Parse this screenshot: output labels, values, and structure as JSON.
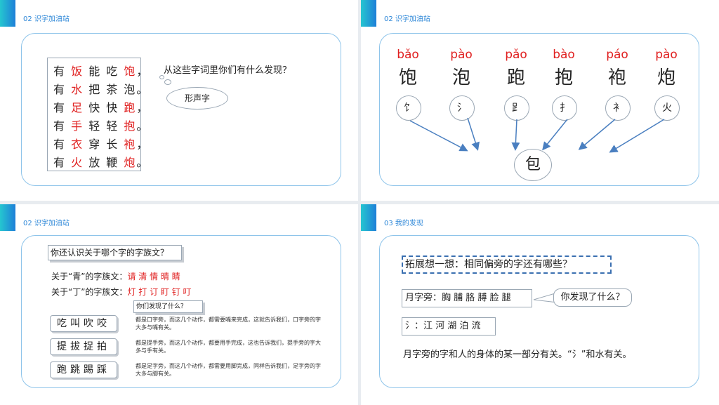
{
  "slides": [
    {
      "section": "02 识字加油站",
      "poem": [
        {
          "a": "有 ",
          "b": "饭",
          "c": " 能 吃 ",
          "d": "饱",
          "e": "，"
        },
        {
          "a": "有 ",
          "b": "水",
          "c": " 把 茶 泡。",
          "d": "",
          "e": ""
        },
        {
          "a": "有 ",
          "b": "足",
          "c": " 快 快 ",
          "d": "跑",
          "e": "，"
        },
        {
          "a": "有 ",
          "b": "手",
          "c": " 轻 轻 ",
          "d": "抱",
          "e": "。"
        },
        {
          "a": "有 ",
          "b": "衣",
          "c": " 穿 长 ",
          "d": "袍",
          "e": "，"
        },
        {
          "a": "有 ",
          "b": "火",
          "c": " 放 鞭 ",
          "d": "炮",
          "e": "。"
        }
      ],
      "question": "从这些字词里你们有什么发现？",
      "cloud": "形声字"
    },
    {
      "section": "02 识字加油站",
      "pinyin": [
        "bǎo",
        "pào",
        "pǎo",
        "bào",
        "páo",
        "pào"
      ],
      "chars": [
        "饱",
        "泡",
        "跑",
        "抱",
        "袍",
        "炮"
      ],
      "radicals": [
        "饣",
        "氵",
        "𧾷",
        "扌",
        "衤",
        "火"
      ],
      "center": "包"
    },
    {
      "section": "02 识字加油站",
      "heading": "你还认识关于哪个字的字族文？",
      "qing_label": "关于“青”的字族文：",
      "qing_words": "请 清 情 晴 睛",
      "ding_label": "关于“丁”的字族文：",
      "ding_words": "灯 打 订 盯 钉 叮",
      "found": "你们发现了什么？",
      "groups": [
        {
          "chars": "吃叫吹咬",
          "desc": "都是口字旁，而这几个动作，都需要嘴来完成，这就告诉我们，口字旁的字大多与嘴有关。"
        },
        {
          "chars": "提拔捉拍",
          "desc": "都是提手旁，而这几个动作，都要用手完成，这也告诉我们，提手旁的字大多与手有关。"
        },
        {
          "chars": "跑跳踢踩",
          "desc": "都是足字旁，而这几个动作，都需要用脚完成，同样告诉我们，足字旁的字大多与脚有关。"
        }
      ]
    },
    {
      "section": "03 我的发现",
      "heading": "拓展想一想：相同偏旁的字还有哪些？",
      "yue": "月字旁：胸 脯 胳 膊 脸 腿",
      "bubble": "你发现了什么？",
      "water": "氵：江 河 湖 泊 流",
      "conclusion": "月字旁的字和人的身体的某一部分有关。“氵”和水有关。"
    }
  ]
}
